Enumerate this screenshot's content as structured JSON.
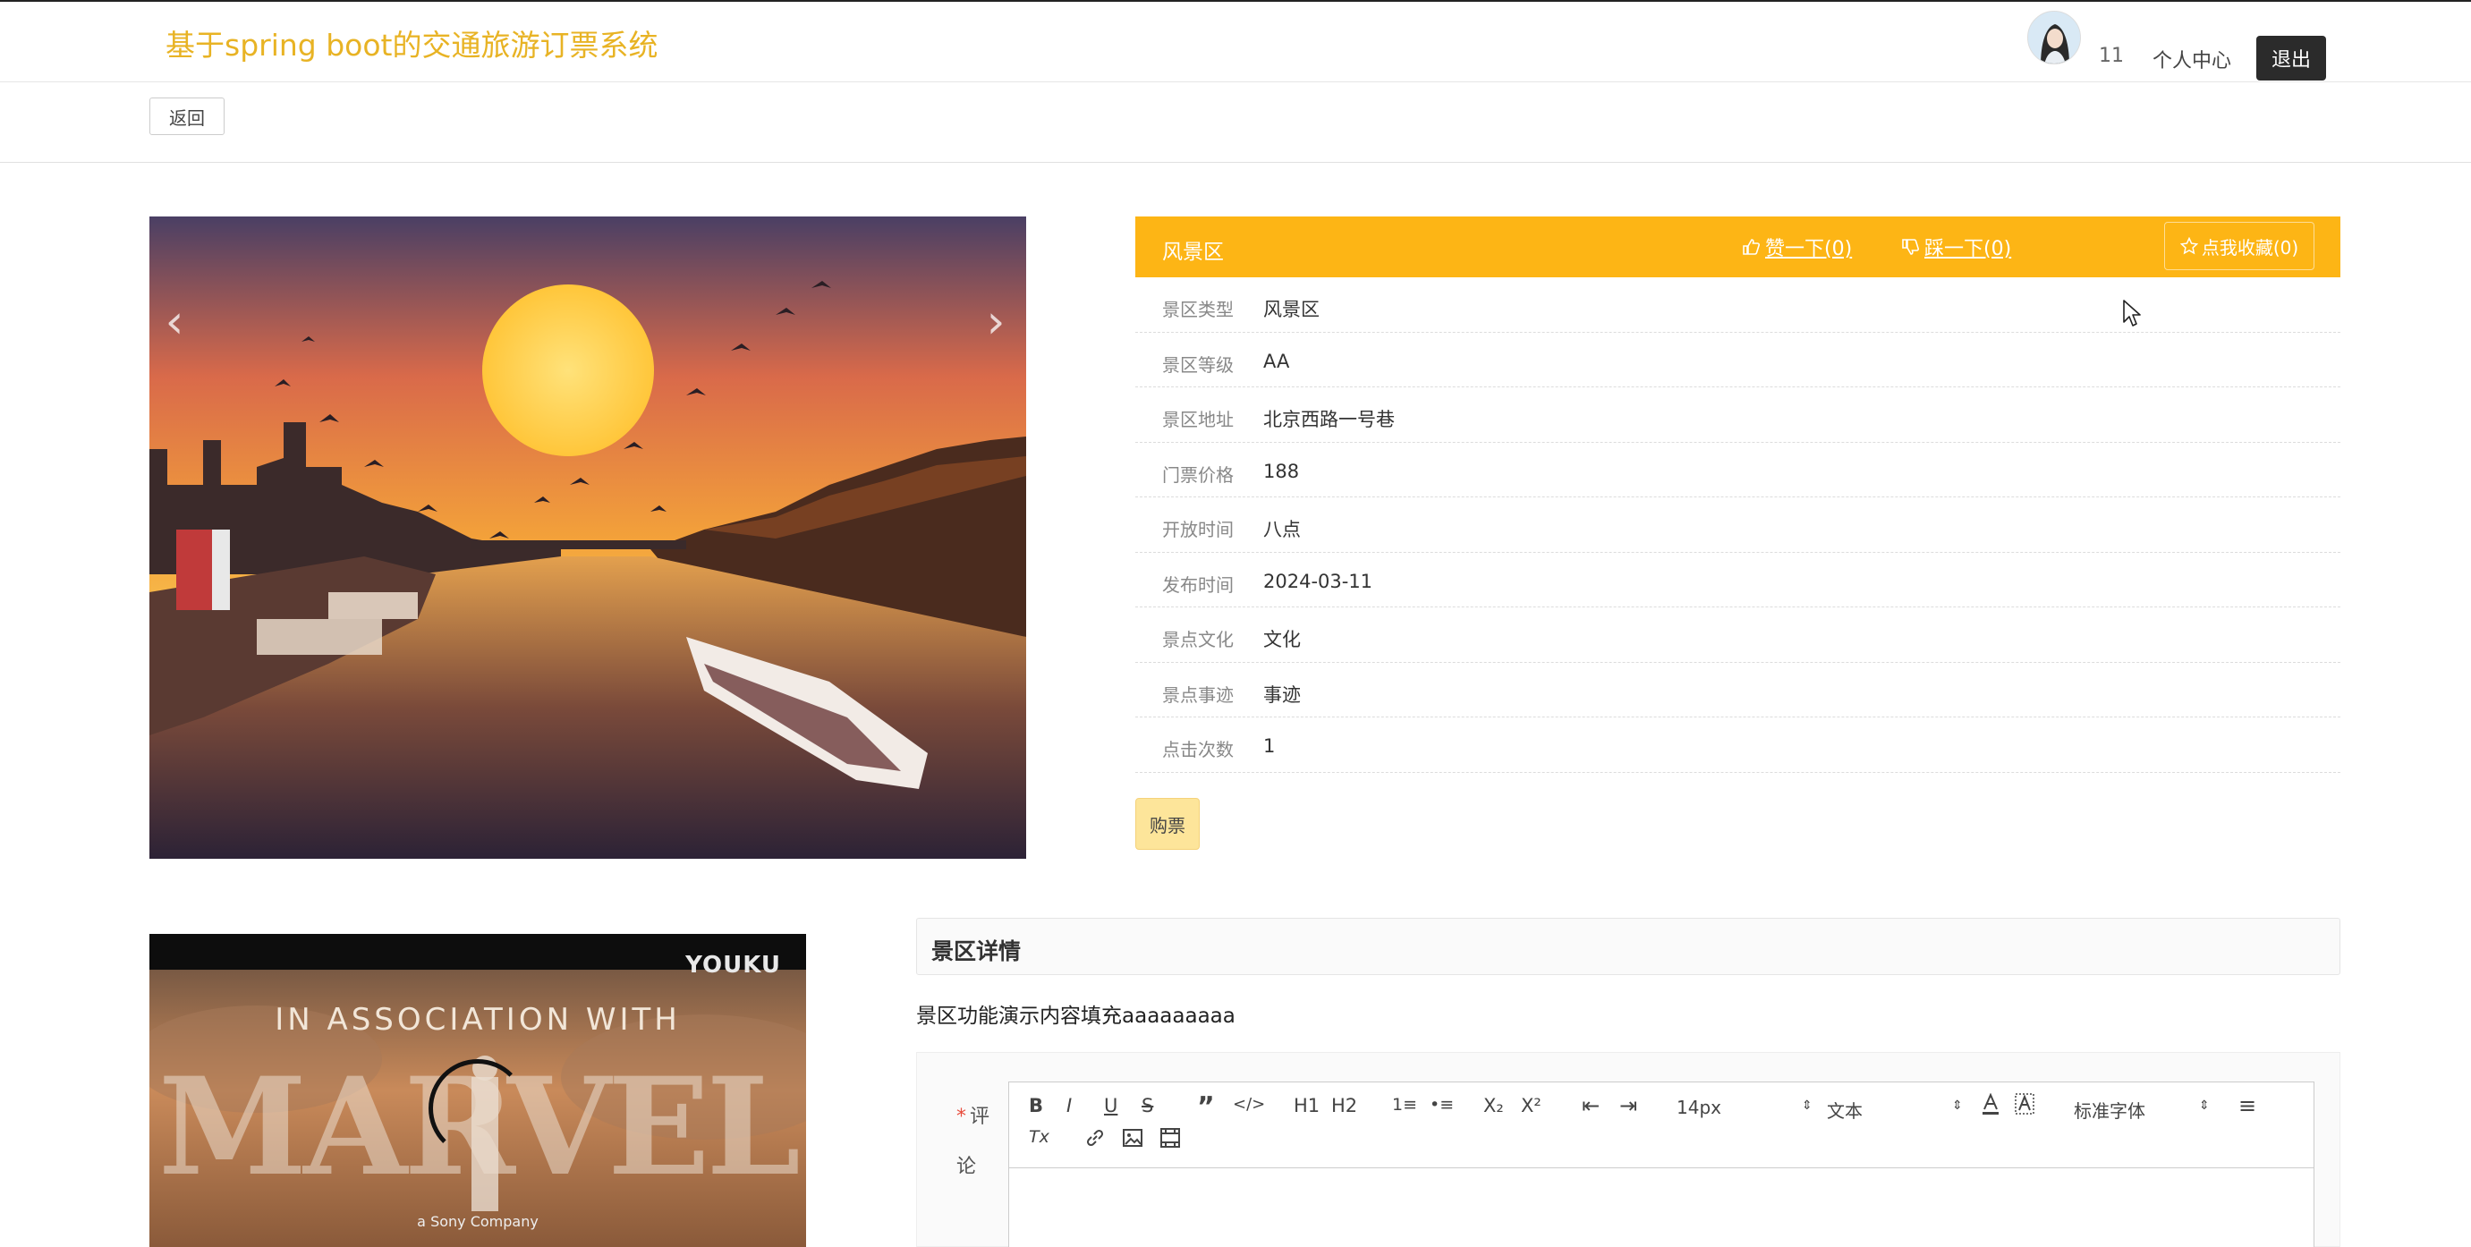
{
  "header": {
    "site_title": "基于spring boot的交通旅游订票系统",
    "username": "11",
    "center_link": "个人中心",
    "logout": "退出"
  },
  "subbar": {
    "back": "返回"
  },
  "carousel": {
    "prev": "‹",
    "next": "›"
  },
  "panel": {
    "title": "风景区",
    "like": "赞一下(0)",
    "dislike": "踩一下(0)",
    "favorite": "点我收藏(0)",
    "rows": [
      {
        "label": "景区类型",
        "value": "风景区"
      },
      {
        "label": "景区等级",
        "value": "AA"
      },
      {
        "label": "景区地址",
        "value": "北京西路一号巷"
      },
      {
        "label": "门票价格",
        "value": "188"
      },
      {
        "label": "开放时间",
        "value": "八点"
      },
      {
        "label": "发布时间",
        "value": "2024-03-11"
      },
      {
        "label": "景点文化",
        "value": "文化"
      },
      {
        "label": "景点事迹",
        "value": "事迹"
      },
      {
        "label": "点击次数",
        "value": "1"
      }
    ],
    "buy": "购票"
  },
  "video": {
    "brand": "YOUKU",
    "assoc": "IN ASSOCIATION WITH",
    "marvel": "MARVEL",
    "sony": "a Sony Company"
  },
  "detail": {
    "title": "景区详情",
    "content": "景区功能演示内容填充aaaaaaaaa"
  },
  "comment": {
    "required": "*",
    "label": "评论",
    "toolbar": {
      "bold": "B",
      "italic": "I",
      "underline": "U",
      "strike": "S",
      "quote": "”",
      "code": "</>",
      "h1": "H1",
      "h2": "H2",
      "ol": "1≡",
      "ul": "•≡",
      "sub": "X₂",
      "sup": "X²",
      "outdent": "⇤",
      "indent": "⇥",
      "size": "14px",
      "header": "文本",
      "font": "标准字体",
      "align": "≡",
      "clean": "Tx"
    }
  }
}
